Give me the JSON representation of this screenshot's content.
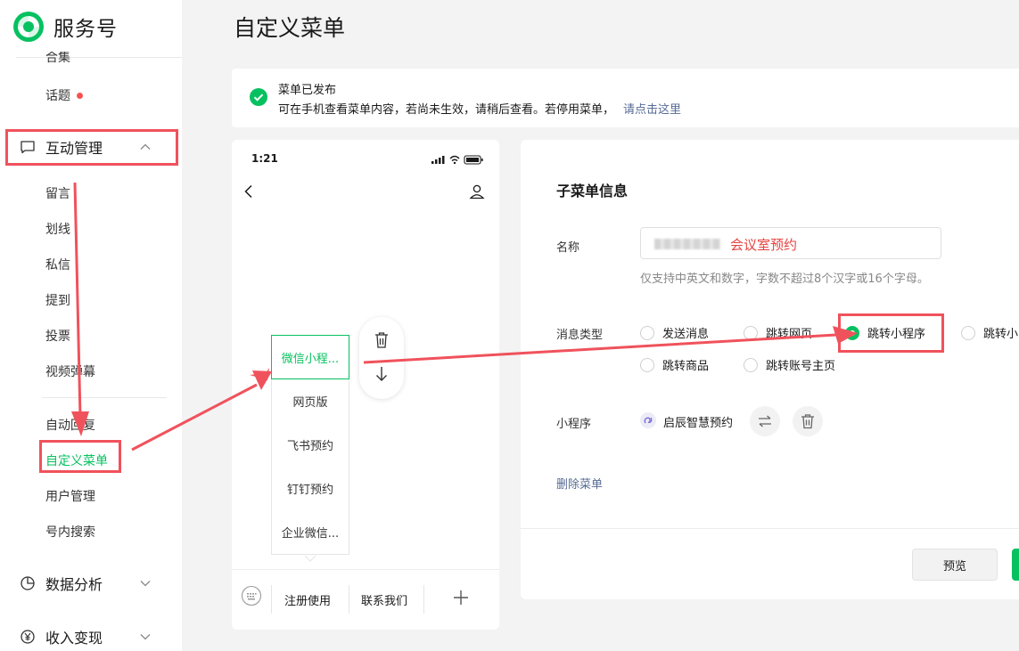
{
  "brand": {
    "name": "服务号",
    "logo_icon": "wechat-service-logo"
  },
  "sidebar": {
    "cut_item": "合集",
    "topic": "话题",
    "interaction_group": "互动管理",
    "interaction_items": [
      "留言",
      "划线",
      "私信",
      "提到",
      "投票",
      "视频弹幕"
    ],
    "tool_items": [
      "自动回复",
      "自定义菜单",
      "用户管理",
      "号内搜索"
    ],
    "active_item": "自定义菜单",
    "data_group": "数据分析",
    "income_group": "收入变现"
  },
  "page": {
    "title": "自定义菜单"
  },
  "notice": {
    "title": "菜单已发布",
    "body": "可在手机查看菜单内容，若尚未生效，请稍后查看。若停用菜单，",
    "link": "请点击这里"
  },
  "phone": {
    "time": "1:21",
    "submenu": [
      "微信小程...",
      "网页版",
      "飞书预约",
      "钉钉预约",
      "企业微信..."
    ],
    "main_menu": [
      "注册使用",
      "联系我们"
    ],
    "add_icon": "plus-icon"
  },
  "form": {
    "section_title": "子菜单信息",
    "name_label": "名称",
    "name_value": "会议室预约",
    "name_hint": "仅支持中英文和数字，字数不超过8个汉字或16个字母。",
    "type_label": "消息类型",
    "type_options": [
      "发送消息",
      "跳转网页",
      "跳转小程序",
      "跳转小",
      "跳转商品",
      "跳转账号主页"
    ],
    "type_selected": "跳转小程序",
    "miniprogram_label": "小程序",
    "miniprogram_name": "启辰智慧预约",
    "delete_link": "删除菜单",
    "preview_button": "预览"
  },
  "colors": {
    "accent": "#07c160",
    "link": "#576b95",
    "annotation": "#f0525c",
    "warning_text": "#e64340"
  }
}
